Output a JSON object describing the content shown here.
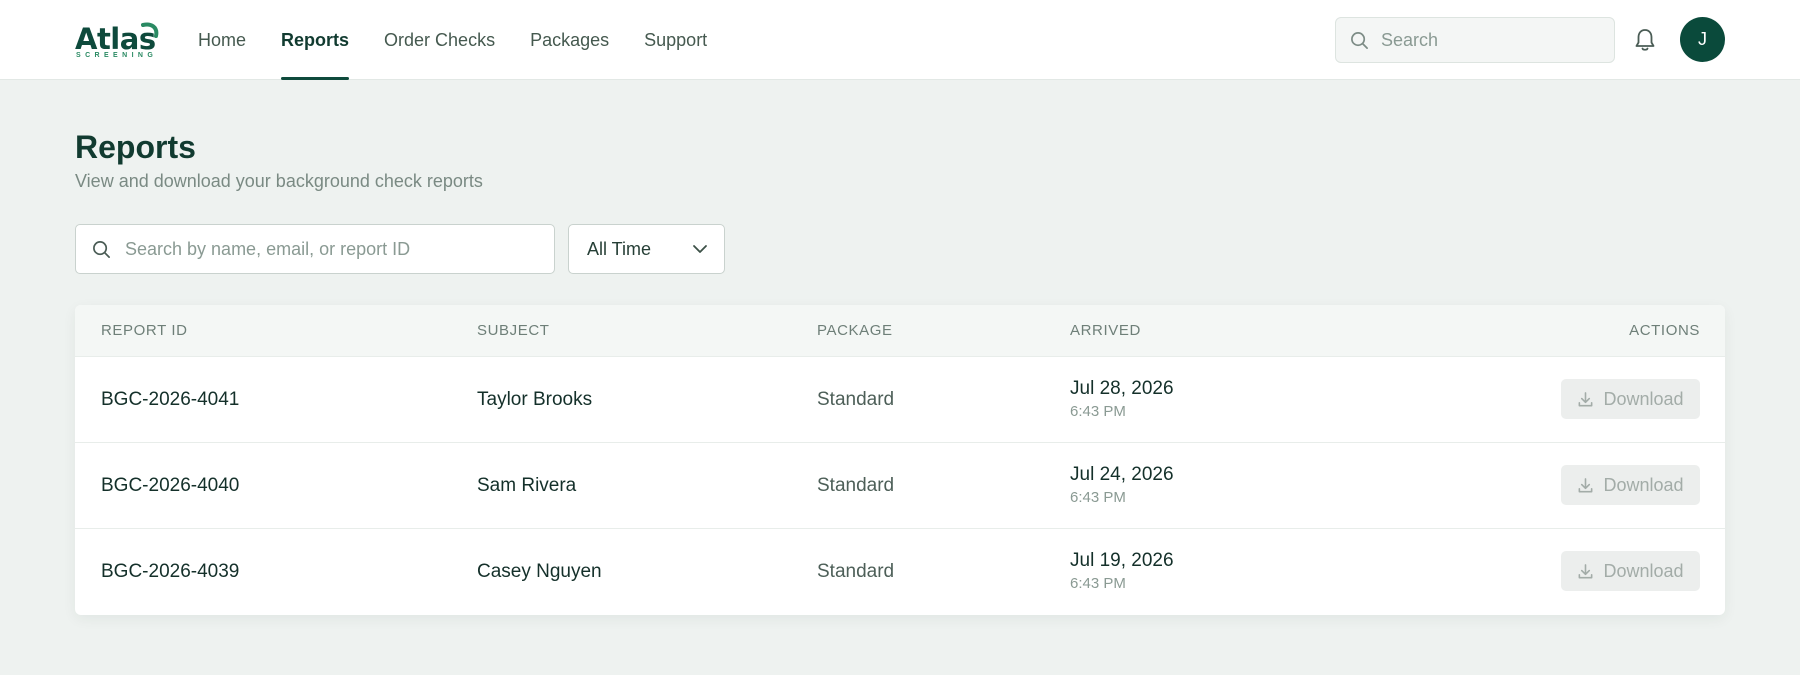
{
  "brand": {
    "name": "Atlas",
    "tagline": "SCREENING"
  },
  "nav": {
    "items": [
      {
        "label": "Home",
        "active": false
      },
      {
        "label": "Reports",
        "active": true
      },
      {
        "label": "Order Checks",
        "active": false
      },
      {
        "label": "Packages",
        "active": false
      },
      {
        "label": "Support",
        "active": false
      }
    ]
  },
  "header": {
    "search_placeholder": "Search",
    "notifications_icon": "bell-icon",
    "avatar_initial": "J"
  },
  "page": {
    "title": "Reports",
    "subtitle": "View and download your background check reports"
  },
  "filters": {
    "search_placeholder": "Search by name, email, or report ID",
    "time_range": {
      "selected": "All Time"
    }
  },
  "table": {
    "columns": {
      "report_id": "REPORT ID",
      "subject": "SUBJECT",
      "package": "PACKAGE",
      "arrived": "ARRIVED",
      "actions": "ACTIONS"
    },
    "rows": [
      {
        "report_id": "BGC-2026-4041",
        "subject": "Taylor Brooks",
        "package": "Standard",
        "arrived_date": "Jul 28, 2026",
        "arrived_time": "6:43 PM",
        "action_label": "Download",
        "action_disabled": true
      },
      {
        "report_id": "BGC-2026-4040",
        "subject": "Sam Rivera",
        "package": "Standard",
        "arrived_date": "Jul 24, 2026",
        "arrived_time": "6:43 PM",
        "action_label": "Download",
        "action_disabled": true
      },
      {
        "report_id": "BGC-2026-4039",
        "subject": "Casey Nguyen",
        "package": "Standard",
        "arrived_date": "Jul 19, 2026",
        "arrived_time": "6:43 PM",
        "action_label": "Download",
        "action_disabled": true
      }
    ]
  },
  "colors": {
    "brand_primary": "#0e4a3c",
    "brand_accent": "#2a8a63",
    "page_background": "#eef2f0",
    "disabled_button": "#eceeed"
  }
}
